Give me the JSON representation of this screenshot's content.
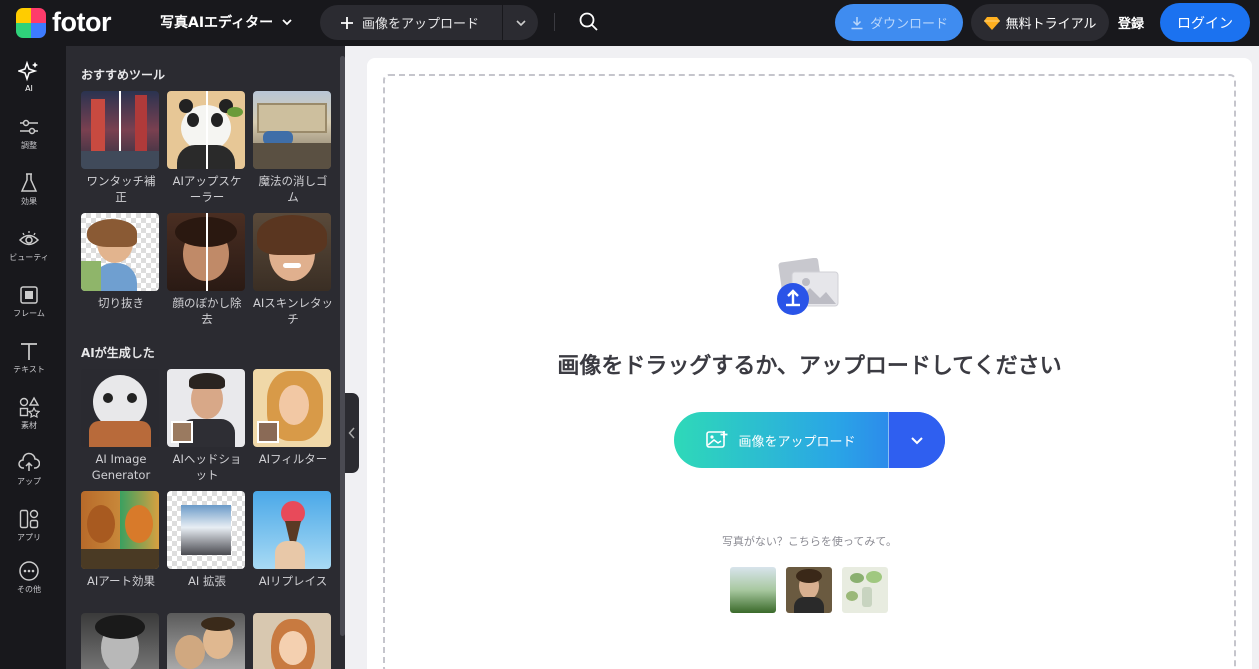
{
  "header": {
    "logo_text": "fotor",
    "editor_label": "写真AIエディター",
    "upload_label": "画像をアップロード",
    "download_label": "ダウンロード",
    "trial_label": "無料トライアル",
    "register_label": "登録",
    "login_label": "ログイン"
  },
  "rail": {
    "items": [
      {
        "label": "AI",
        "icon": "sparkle-icon"
      },
      {
        "label": "調整",
        "icon": "sliders-icon"
      },
      {
        "label": "効果",
        "icon": "flask-icon"
      },
      {
        "label": "ビューティ",
        "icon": "eye-icon"
      },
      {
        "label": "フレーム",
        "icon": "frame-icon"
      },
      {
        "label": "テキスト",
        "icon": "text-icon"
      },
      {
        "label": "素材",
        "icon": "shapes-icon"
      },
      {
        "label": "アップ",
        "icon": "cloud-upload-icon"
      },
      {
        "label": "アプリ",
        "icon": "apps-icon"
      },
      {
        "label": "その他",
        "icon": "more-icon"
      }
    ]
  },
  "panel": {
    "section1_title": "おすすめツール",
    "section2_title": "AIが生成した",
    "tools": [
      {
        "label": "ワンタッチ補正"
      },
      {
        "label": "AIアップスケーラー"
      },
      {
        "label": "魔法の消しゴム"
      },
      {
        "label": "切り抜き"
      },
      {
        "label": "顔のぼかし除去"
      },
      {
        "label": "AIスキンレタッチ"
      },
      {
        "label": "AI Image Generator"
      },
      {
        "label": "AIヘッドショット"
      },
      {
        "label": "AIフィルター"
      },
      {
        "label": "AIアート効果"
      },
      {
        "label": "AI 拡張"
      },
      {
        "label": "AIリプレイス"
      }
    ]
  },
  "workspace": {
    "drop_title": "画像をドラッグするか、アップロードしてください",
    "upload_button_label": "画像をアップロード",
    "hint": "写真がない？こちらを使ってみて。"
  }
}
